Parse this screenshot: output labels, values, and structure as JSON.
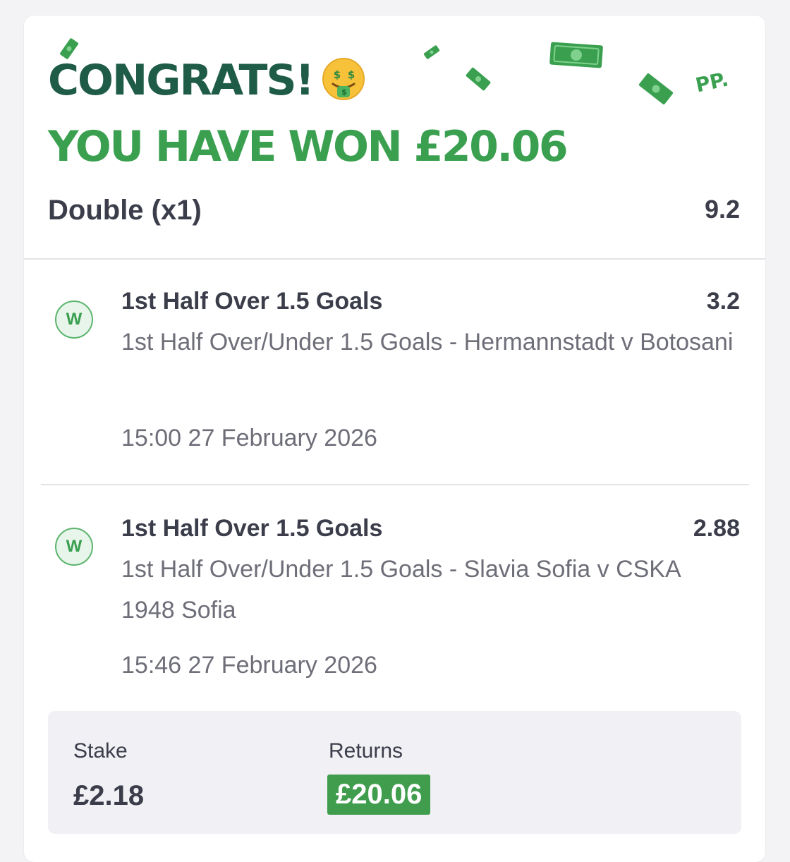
{
  "banner": {
    "line1": "CONGRATS!",
    "line2": "YOU HAVE WON £20.06",
    "logo": "PP.",
    "emoji": "money-mouth-face-icon",
    "decoration": "banknote-confetti-icon"
  },
  "bet": {
    "type": "Double (x1)",
    "odds": "9.2"
  },
  "selections": [
    {
      "badge": "W",
      "title": "1st Half Over 1.5 Goals",
      "odds": "3.2",
      "market": "1st Half Over/Under 1.5 Goals - Hermannstadt v Botosani",
      "time": "15:00 27 February 2026"
    },
    {
      "badge": "W",
      "title": "1st Half Over 1.5 Goals",
      "odds": "2.88",
      "market": "1st Half Over/Under 1.5 Goals - Slavia Sofia v CSKA 1948 Sofia",
      "time": "15:46 27 February 2026"
    }
  ],
  "summary": {
    "stake_label": "Stake",
    "stake_value": "£2.18",
    "returns_label": "Returns",
    "returns_value": "£20.06"
  },
  "colors": {
    "brand_dark_green": "#1f5c47",
    "brand_green": "#3aa050",
    "returns_badge": "#3f9d4d",
    "text_primary": "#3b3d4a",
    "text_secondary": "#6d6e78"
  }
}
